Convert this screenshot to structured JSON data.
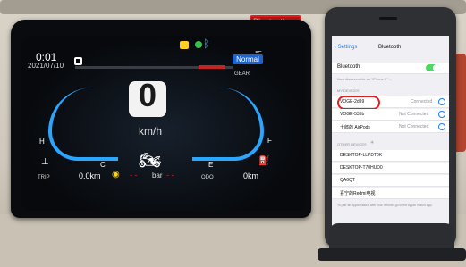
{
  "dashboard": {
    "time": "0:01",
    "date": "2021/07/10",
    "mode_badge": "Normal",
    "temp_unit": "℃",
    "gear_label": "GEAR",
    "gear_value": "0",
    "speed_unit": "km/h",
    "letter_c": "C",
    "letter_h": "H",
    "letter_e": "E",
    "letter_f": "F",
    "trip_label": "TRIP",
    "trip_value": "0.0km",
    "bar_label": "bar",
    "odo_label": "ODO",
    "odo_value": "0km",
    "annotation": "Bluetooth"
  },
  "phone": {
    "back_label": "Settings",
    "page_title": "Bluetooth",
    "row_bluetooth": "Bluetooth",
    "discoverable_note": "Now discoverable as \"iPhone 2\" ...",
    "my_devices_header": "MY DEVICES",
    "my_devices": [
      {
        "name": "VOGE-2d99",
        "status": "Connected"
      },
      {
        "name": "VOGE-535b",
        "status": "Not Connected"
      },
      {
        "name": "士郎的 AirPods",
        "status": "Not Connected"
      }
    ],
    "other_devices_header": "OTHER DEVICES",
    "other_devices": [
      "DESKTOP-LLPDT0K",
      "DESKTOP-T70HUD0",
      "QA6QT",
      "喜宁的Redmi电视"
    ],
    "footer_note": "To pair an Apple Watch with your iPhone, go to the Apple Watch app."
  },
  "colors": {
    "annotation_red": "#e02020",
    "ios_blue": "#1a7cf5",
    "ios_green": "#4cd964",
    "dash_blue": "#2aa6ff"
  }
}
